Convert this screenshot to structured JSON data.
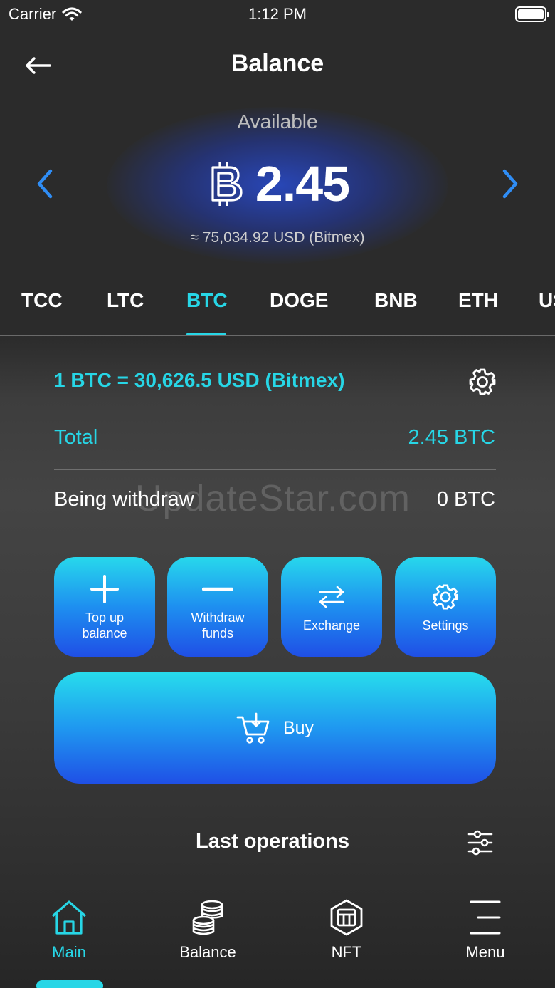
{
  "status_bar": {
    "carrier": "Carrier",
    "time": "1:12 PM"
  },
  "header": {
    "title": "Balance",
    "back_icon": "arrow-left-icon"
  },
  "hero": {
    "label": "Available",
    "currency_icon": "bitcoin-icon",
    "amount": "2.45",
    "usd_approx": "≈ 75,034.92 USD (Bitmex)"
  },
  "tabs": [
    {
      "label": "TCC"
    },
    {
      "label": "LTC"
    },
    {
      "label": "BTC",
      "active": true
    },
    {
      "label": "DOGE"
    },
    {
      "label": "BNB"
    },
    {
      "label": "ETH"
    },
    {
      "label": "US"
    }
  ],
  "rate": {
    "text": "1 BTC = 30,626.5 USD (Bitmex)"
  },
  "total": {
    "label": "Total",
    "value": "2.45 BTC"
  },
  "being_withdraw": {
    "label": "Being withdraw",
    "value": "0 BTC"
  },
  "watermark": "UpdateStar.com",
  "actions": [
    {
      "label": "Top up balance",
      "icon": "plus-icon"
    },
    {
      "label": "Withdraw funds",
      "icon": "minus-icon"
    },
    {
      "label": "Exchange",
      "icon": "exchange-arrows-icon"
    },
    {
      "label": "Settings",
      "icon": "gear-icon"
    }
  ],
  "buy": {
    "label": "Buy",
    "icon": "cart-icon"
  },
  "last_operations": {
    "title": "Last operations",
    "icon": "filter-sliders-icon"
  },
  "bottom_nav": [
    {
      "label": "Main",
      "icon": "home-icon",
      "active": true
    },
    {
      "label": "Balance",
      "icon": "coins-stack-icon"
    },
    {
      "label": "NFT",
      "icon": "nft-icon"
    },
    {
      "label": "Menu",
      "icon": "menu-lines-icon"
    }
  ],
  "colors": {
    "accent": "#27d6e6",
    "button_top": "#27d8ec",
    "button_bottom": "#1f4fe6"
  }
}
